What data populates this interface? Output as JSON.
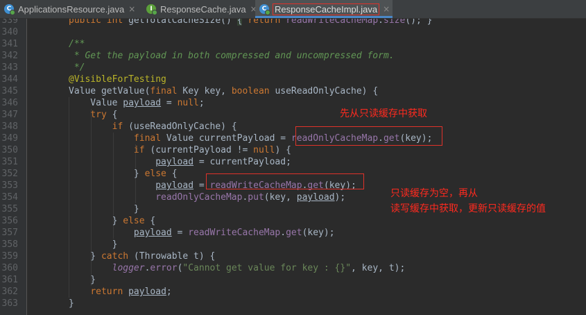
{
  "tabs": [
    {
      "label": "ApplicationsResource.java",
      "icon": "class-icon",
      "active": false
    },
    {
      "label": "ResponseCache.java",
      "icon": "interface-icon",
      "active": false
    },
    {
      "label": "ResponseCacheImpl.java",
      "icon": "class-icon",
      "active": true
    }
  ],
  "close_glyph": "×",
  "colors": {
    "background": "#2b2b2b",
    "keyword": "#cc7832",
    "comment": "#629755",
    "annotation": "#bbb529",
    "field": "#9876aa",
    "string": "#6a8759",
    "callout": "#e0322a"
  },
  "editor": {
    "lines": [
      {
        "num": "339",
        "code": "public int getTotalCacheSize() { return readWriteCacheMap.size(); }"
      },
      {
        "num": "340",
        "code": ""
      },
      {
        "num": "341",
        "code": "/**"
      },
      {
        "num": "342",
        "code": " * Get the payload in both compressed and uncompressed form."
      },
      {
        "num": "343",
        "code": " */"
      },
      {
        "num": "344",
        "code": "@VisibleForTesting"
      },
      {
        "num": "345",
        "code": "Value getValue(final Key key, boolean useReadOnlyCache) {"
      },
      {
        "num": "346",
        "code": "    Value payload = null;"
      },
      {
        "num": "347",
        "code": "    try {"
      },
      {
        "num": "348",
        "code": "        if (useReadOnlyCache) {"
      },
      {
        "num": "349",
        "code": "            final Value currentPayload = readOnlyCacheMap.get(key);"
      },
      {
        "num": "350",
        "code": "            if (currentPayload != null) {"
      },
      {
        "num": "351",
        "code": "                payload = currentPayload;"
      },
      {
        "num": "352",
        "code": "            } else {"
      },
      {
        "num": "353",
        "code": "                payload = readWriteCacheMap.get(key);"
      },
      {
        "num": "354",
        "code": "                readOnlyCacheMap.put(key, payload);"
      },
      {
        "num": "355",
        "code": "            }"
      },
      {
        "num": "356",
        "code": "        } else {"
      },
      {
        "num": "357",
        "code": "            payload = readWriteCacheMap.get(key);"
      },
      {
        "num": "358",
        "code": "        }"
      },
      {
        "num": "359",
        "code": "    } catch (Throwable t) {"
      },
      {
        "num": "360",
        "code": "        logger.error(\"Cannot get value for key : {}\", key, t);"
      },
      {
        "num": "361",
        "code": "    }"
      },
      {
        "num": "362",
        "code": "    return payload;"
      },
      {
        "num": "363",
        "code": "}"
      }
    ]
  },
  "annotations": {
    "note_read_only": "先从只读缓存中获取",
    "note_read_write_line1": "只读缓存为空，再从",
    "note_read_write_line2": "读写缓存中获取，更新只读缓存的值"
  }
}
